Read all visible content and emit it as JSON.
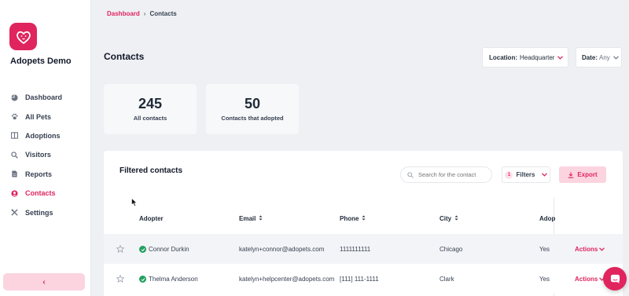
{
  "app": {
    "brand": "Adopets Demo"
  },
  "sidebar": {
    "items": [
      {
        "label": "Dashboard",
        "icon": "pie-chart-icon",
        "active": false
      },
      {
        "label": "All Pets",
        "icon": "paw-icon",
        "active": false
      },
      {
        "label": "Adoptions",
        "icon": "columns-icon",
        "active": false
      },
      {
        "label": "Visitors",
        "icon": "search-icon",
        "active": false
      },
      {
        "label": "Reports",
        "icon": "file-icon",
        "active": false
      },
      {
        "label": "Contacts",
        "icon": "user-circle-icon",
        "active": true
      },
      {
        "label": "Settings",
        "icon": "tools-icon",
        "active": false
      }
    ],
    "collapse_label": "‹"
  },
  "breadcrumb": {
    "parent": "Dashboard",
    "separator": "›",
    "current": "Contacts"
  },
  "page": {
    "title": "Contacts"
  },
  "location_filter": {
    "label": "Location:",
    "value": "Headquarter"
  },
  "date_filter": {
    "label": "Date:",
    "value": "Any"
  },
  "stats": [
    {
      "value": "245",
      "label": "All contacts"
    },
    {
      "value": "50",
      "label": "Contacts that adopted"
    }
  ],
  "table_card": {
    "title": "Filtered contacts",
    "search_placeholder": "Search for the contact",
    "filters_label": "Filters",
    "filters_count": "1",
    "export_label": "Export",
    "columns": [
      "Adopter",
      "Email",
      "Phone",
      "City",
      "Adop"
    ],
    "rows": [
      {
        "name": "Connor Durkin",
        "email": "katelyn+connor@adopets.com",
        "phone": "1111111111",
        "city": "Chicago",
        "adopted": "Yes",
        "actions": "Actions"
      },
      {
        "name": "Thelma Anderson",
        "email": "katelyn+helpcenter@adopets.com",
        "phone": "[111] 111-1111",
        "city": "Clark",
        "adopted": "Yes",
        "actions": "Actions"
      }
    ]
  },
  "colors": {
    "accent": "#e0245e",
    "accent_soft": "#fbd4e0",
    "success": "#22a060",
    "background": "#eef0f4"
  }
}
